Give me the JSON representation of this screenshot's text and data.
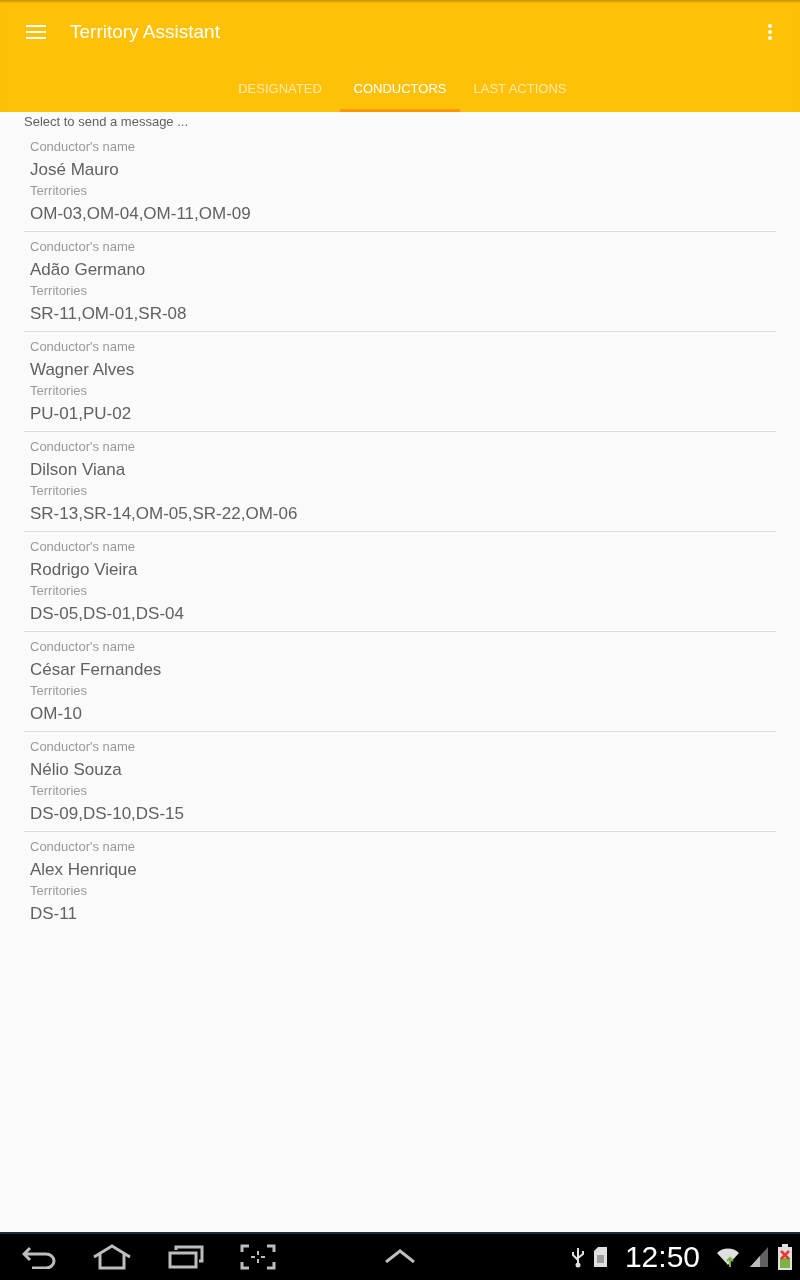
{
  "app_bar": {
    "title": "Territory Assistant"
  },
  "tabs": [
    {
      "label": "DESIGNATED",
      "selected": false
    },
    {
      "label": "CONDUCTORS",
      "selected": true
    },
    {
      "label": "LAST ACTIONS",
      "selected": false
    }
  ],
  "hint": "Select to send a message ...",
  "conductors": [
    {
      "name_label": "Conductor's name",
      "name": "José Mauro",
      "territories_label": "Territories",
      "territories": "OM-03,OM-04,OM-11,OM-09"
    },
    {
      "name_label": "Conductor's name",
      "name": "Adão Germano",
      "territories_label": "Territories",
      "territories": "SR-11,OM-01,SR-08"
    },
    {
      "name_label": "Conductor's name",
      "name": "Wagner Alves",
      "territories_label": "Territories",
      "territories": "PU-01,PU-02"
    },
    {
      "name_label": "Conductor's name",
      "name": "Dilson Viana",
      "territories_label": "Territories",
      "territories": "SR-13,SR-14,OM-05,SR-22,OM-06"
    },
    {
      "name_label": "Conductor's name",
      "name": "Rodrigo Vieira",
      "territories_label": "Territories",
      "territories": "DS-05,DS-01,DS-04"
    },
    {
      "name_label": "Conductor's name",
      "name": "César Fernandes",
      "territories_label": "Territories",
      "territories": "OM-10"
    },
    {
      "name_label": "Conductor's name",
      "name": "Nélio Souza",
      "territories_label": "Territories",
      "territories": "DS-09,DS-10,DS-15"
    },
    {
      "name_label": "Conductor's name",
      "name": "Alex Henrique",
      "territories_label": "Territories",
      "territories": "DS-11"
    }
  ],
  "system_bar": {
    "time": "12:50"
  }
}
